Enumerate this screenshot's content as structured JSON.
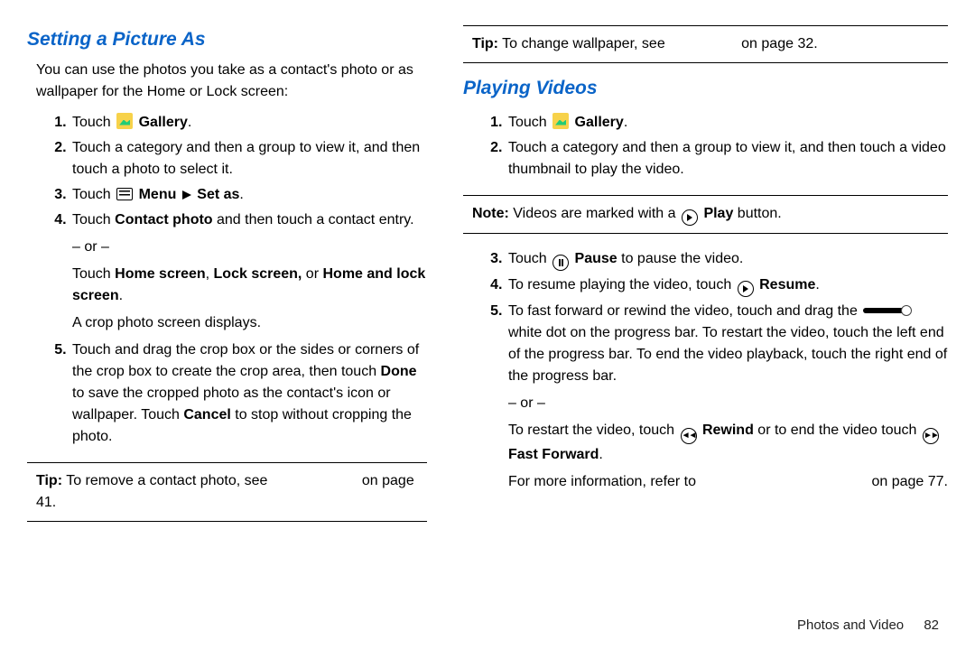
{
  "left": {
    "heading": "Setting a Picture As",
    "intro": "You can use the photos you take as a contact's photo or as wallpaper for the Home or Lock screen:",
    "s1_touch": "Touch ",
    "s1_gallery": "Gallery",
    "s1_period": ".",
    "s2": "Touch a category and then a group to view it, and then touch a photo to select it.",
    "s3_touch": "Touch ",
    "s3_menu": "Menu ",
    "s3_setas": "Set as",
    "s3_period": ".",
    "s4_a": "Touch ",
    "s4_b": "Contact photo",
    "s4_c": " and then touch a contact entry.",
    "s4_or": "– or –",
    "s4_d": "Touch ",
    "s4_home": "Home screen",
    "s4_comma1": ", ",
    "s4_lock": "Lock screen,",
    "s4_or2": " or ",
    "s4_hal": "Home and lock screen",
    "s4_period": ".",
    "s4_crop": "A crop photo screen displays.",
    "s5_a": "Touch and drag the crop box or the sides or corners of the crop box to create the crop area, then touch ",
    "s5_done": "Done",
    "s5_b": " to save the cropped photo as the contact's icon or wallpaper. Touch ",
    "s5_cancel": "Cancel",
    "s5_c": " to stop without cropping the photo.",
    "tip_label": "Tip:",
    "tip_text": " To remove a contact photo, see ",
    "tip_on": "on page 41."
  },
  "right": {
    "tip1_label": "Tip:",
    "tip1_text": " To change wallpaper, see ",
    "tip1_on": "on page 32.",
    "heading": "Playing Videos",
    "s1_touch": "Touch ",
    "s1_gallery": "Gallery",
    "s1_period": ".",
    "s2": "Touch a category and then a group to view it, and then touch a video thumbnail to play the video.",
    "note_label": "Note:",
    "note_text_a": " Videos are marked with a ",
    "note_play": "Play",
    "note_text_b": " button.",
    "s3_a": "Touch ",
    "s3_pause": "Pause",
    "s3_b": " to pause the video.",
    "s4_a": "To resume playing the video, touch ",
    "s4_resume": "Resume",
    "s4_b": ".",
    "s5_a": "To fast forward or rewind the video, touch and drag the ",
    "s5_b": " white dot on the progress bar. To restart the video, touch the left end of the progress bar. To end the video playback, touch the right end of the progress bar.",
    "s5_or": "– or –",
    "s5_c": "To restart the video, touch ",
    "s5_rewind": "Rewind",
    "s5_d": " or to end the video touch ",
    "s5_ff": "Fast Forward",
    "s5_period": ".",
    "more_a": "For more information, refer to ",
    "more_b": "on page 77."
  },
  "footer": {
    "section": "Photos and Video",
    "page": "82"
  }
}
